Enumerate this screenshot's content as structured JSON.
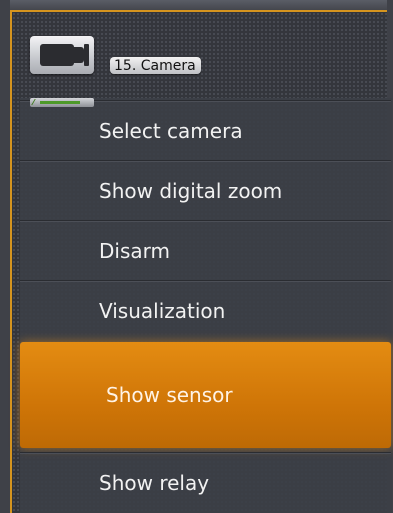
{
  "camera": {
    "label": "15. Camera",
    "icon": "video-camera-icon",
    "status_icon": "signal-status-icon"
  },
  "menu": {
    "items": [
      {
        "label": "Select camera"
      },
      {
        "label": "Show digital zoom"
      },
      {
        "label": "Disarm"
      },
      {
        "label": "Visualization"
      },
      {
        "label": "Show sensor",
        "highlighted": true
      },
      {
        "label": "Show relay"
      }
    ]
  },
  "colors": {
    "accent": "#d6951f",
    "highlight": "#d67b0a",
    "menu_bg": "#3c3f47",
    "text": "#f2f2f2"
  }
}
